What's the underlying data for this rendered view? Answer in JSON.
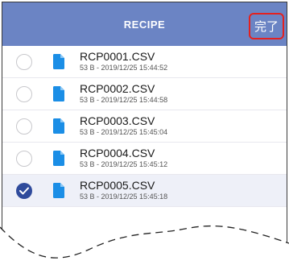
{
  "header": {
    "title": "RECIPE",
    "done_label": "完了"
  },
  "colors": {
    "header_bg": "#6b84c4",
    "done_outline": "#e4211f",
    "selected_check": "#2f4b9c",
    "file_icon": "#1b8ee6"
  },
  "files": [
    {
      "name": "RCP0001.CSV",
      "meta": "53 B - 2019/12/25 15:44:52",
      "selected": false,
      "icon": "file-icon"
    },
    {
      "name": "RCP0002.CSV",
      "meta": "53 B - 2019/12/25 15:44:58",
      "selected": false,
      "icon": "file-icon"
    },
    {
      "name": "RCP0003.CSV",
      "meta": "53 B - 2019/12/25 15:45:04",
      "selected": false,
      "icon": "file-icon"
    },
    {
      "name": "RCP0004.CSV",
      "meta": "53 B - 2019/12/25 15:45:12",
      "selected": false,
      "icon": "file-icon"
    },
    {
      "name": "RCP0005.CSV",
      "meta": "53 B - 2019/12/25 15:45:18",
      "selected": true,
      "icon": "file-icon"
    }
  ]
}
